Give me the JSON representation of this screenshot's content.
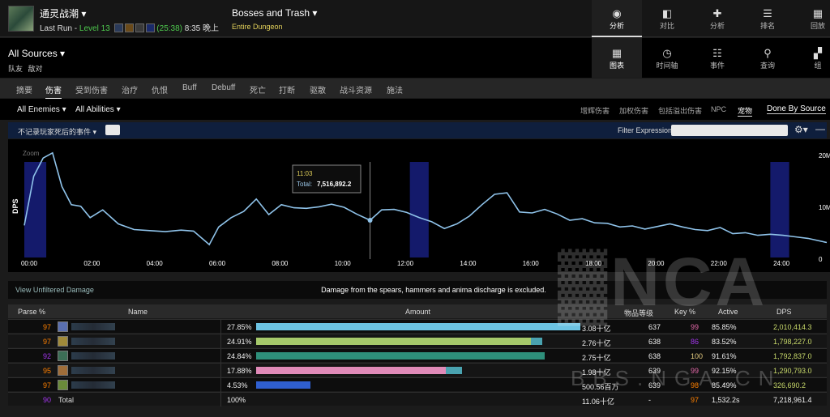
{
  "topbar": {
    "zone_name": "通灵战潮 ▾",
    "run_label": "Last Run",
    "level": "Level 13",
    "timer": "(25:38)",
    "date": "8:35 晚上",
    "boss_title": "Bosses and Trash ▾",
    "boss_sub": "Entire Dungeon",
    "nav": [
      {
        "icon": "eye-icon",
        "label": "分析",
        "active": true
      },
      {
        "icon": "compare-icon",
        "label": "对比"
      },
      {
        "icon": "puzzle-icon",
        "label": "分析"
      },
      {
        "icon": "ranking-icon",
        "label": "排名"
      },
      {
        "icon": "replay-icon",
        "label": "回放"
      }
    ]
  },
  "secondbar": {
    "sources": "All Sources ▾",
    "sources_sub": "队友 敌对",
    "nav": [
      {
        "icon": "table-icon",
        "label": "图表",
        "active": true
      },
      {
        "icon": "clock-icon",
        "label": "时间轴"
      },
      {
        "icon": "list-icon",
        "label": "事件"
      },
      {
        "icon": "pin-icon",
        "label": "查询"
      },
      {
        "icon": "group-icon",
        "label": "组"
      }
    ]
  },
  "tabs": [
    "摘要",
    "伤害",
    "受到伤害",
    "治疗",
    "仇恨",
    "Buff",
    "Debuff",
    "死亡",
    "打断",
    "驱散",
    "战斗资源",
    "施法"
  ],
  "active_tab": 1,
  "filters": {
    "enemies": "All Enemies ▾",
    "abilities": "All Abilities ▾",
    "options": [
      "增辉伤害",
      "加权伤害",
      "包括溢出伤害",
      "NPC",
      "宠物"
    ],
    "active_option": 4,
    "done_by": "Done By Source"
  },
  "graph_header": {
    "death_filter": "不记录玩家死后的事件 ▾",
    "filter_label": "Filter Expression:",
    "gear_icon": "gear-icon",
    "minimize": "—"
  },
  "chart_data": {
    "type": "line",
    "ylabel": "DPS",
    "zoom_label": "Zoom",
    "x_ticks": [
      "00:00",
      "02:00",
      "04:00",
      "06:00",
      "08:00",
      "10:00",
      "12:00",
      "14:00",
      "16:00",
      "18:00",
      "20:00",
      "22:00",
      "24:00"
    ],
    "y_ticks": [
      "20M",
      "10M",
      "0"
    ],
    "x_range_min": [
      0,
      25.6
    ],
    "y_range_m": [
      0,
      20
    ],
    "highlight_bands_min": [
      [
        0.0,
        0.7
      ],
      [
        12.3,
        12.9
      ],
      [
        23.8,
        24.4
      ]
    ],
    "series": [
      {
        "x": [
          0,
          0.3,
          0.6,
          0.9,
          1.2,
          1.5,
          1.8,
          2.1,
          2.5,
          3.0,
          3.5,
          4.0,
          4.5,
          5.0,
          5.4,
          5.9,
          6.2,
          6.6,
          7.0,
          7.4,
          7.8,
          8.2,
          8.6,
          9.0,
          9.4,
          9.8,
          10.2,
          10.6,
          11.03,
          11.4,
          11.8,
          12.2,
          12.6,
          13.0,
          13.4,
          13.8,
          14.2,
          14.6,
          15.0,
          15.4,
          15.8,
          16.2,
          16.6,
          17.0,
          17.4,
          17.8,
          18.2,
          18.6,
          19.0,
          19.4,
          19.8,
          20.2,
          20.6,
          21.0,
          21.4,
          21.8,
          22.2,
          22.6,
          23.0,
          23.4,
          23.8,
          24.2,
          24.6,
          25.0,
          25.6
        ],
        "y_m": [
          6.5,
          16,
          19.5,
          20.5,
          14,
          10.5,
          10.2,
          8,
          9.5,
          6.8,
          5.7,
          5.5,
          5.3,
          5.6,
          5.4,
          2.8,
          6.2,
          8.0,
          9.2,
          11.6,
          8.6,
          10.5,
          9.9,
          9.8,
          10.1,
          10.6,
          10.0,
          8.7,
          7.5,
          9.5,
          9.6,
          9.0,
          8.0,
          7.2,
          5.9,
          6.8,
          8.3,
          10.5,
          12.5,
          12.8,
          9.1,
          8.9,
          9.6,
          8.7,
          7.5,
          7.8,
          7.0,
          6.9,
          6.2,
          6.4,
          5.8,
          6.3,
          6.8,
          6.2,
          5.7,
          5.5,
          6.1,
          4.9,
          5.1,
          4.6,
          4.8,
          4.6,
          4.3,
          4.0,
          3.2
        ]
      }
    ],
    "tooltip": {
      "time": "11:03",
      "label": "Total:",
      "value": "7,516,892.2",
      "x_min": 11.03,
      "y_m": 7.5
    }
  },
  "note_row": {
    "unfiltered": "View Unfiltered Damage",
    "note": "Damage from the spears, hammers and anima discharge is excluded."
  },
  "table": {
    "headers": {
      "parse": "Parse %",
      "name": "Name",
      "amount": "Amount",
      "ilvl": "物品等级",
      "key": "Key %",
      "active": "Active",
      "dps": "DPS"
    },
    "rows": [
      {
        "parse": "97",
        "parse_color": "#ff8000",
        "icon_color": "#5a6fb0",
        "pct": "27.85%",
        "fill": 1.0,
        "ext": 0.0,
        "bar_color": "#6cc3e2",
        "amount": "3.08十亿",
        "ilvl": "637",
        "key": "99",
        "key_color": "#e268a8",
        "active": "85.85%",
        "dps": "2,010,414.3",
        "dps_color": "#c8d96a"
      },
      {
        "parse": "97",
        "parse_color": "#ff8000",
        "icon_color": "#a08a3a",
        "pct": "24.91%",
        "fill": 0.848,
        "ext": 0.034,
        "bar_color": "#a6c96b",
        "amount": "2.76十亿",
        "ilvl": "638",
        "key": "86",
        "key_color": "#a335ee",
        "active": "83.52%",
        "dps": "1,798,227.0",
        "dps_color": "#c8d96a"
      },
      {
        "parse": "92",
        "parse_color": "#a335ee",
        "icon_color": "#3c6e56",
        "pct": "24.84%",
        "fill": 0.89,
        "ext": 0.0,
        "bar_color": "#2e8f7a",
        "amount": "2.75十亿",
        "ilvl": "638",
        "key": "100",
        "key_color": "#e5cc80",
        "active": "91.61%",
        "dps": "1,792,837.0",
        "dps_color": "#c8d96a"
      },
      {
        "parse": "95",
        "parse_color": "#ff8000",
        "icon_color": "#a06e3a",
        "pct": "17.88%",
        "fill": 0.586,
        "ext": 0.05,
        "bar_color": "#e08ab8",
        "amount": "1.98十亿",
        "ilvl": "639",
        "key": "99",
        "key_color": "#e268a8",
        "active": "92.15%",
        "dps": "1,290,793.0",
        "dps_color": "#c8d96a"
      },
      {
        "parse": "97",
        "parse_color": "#ff8000",
        "icon_color": "#6a8a3a",
        "pct": "4.53%",
        "fill": 0.168,
        "ext": 0.0,
        "bar_color": "#2f5fd0",
        "amount": "500.56百万",
        "ilvl": "639",
        "key": "98",
        "key_color": "#ff8000",
        "active": "85.49%",
        "dps": "326,690.2",
        "dps_color": "#c8d96a"
      }
    ],
    "total": {
      "parse": "90",
      "name": "Total",
      "pct": "100%",
      "amount": "11.06十亿",
      "ilvl": "-",
      "key": "97",
      "active": "1,532.2s",
      "dps": "7,218,961.4"
    }
  },
  "watermark": {
    "logo": "NCA",
    "site": "BBS.NGA.CN"
  },
  "colors": {
    "accent_line": "#8fc3ea",
    "band": "#141a6b",
    "page_bg": "#1b1b1b"
  }
}
